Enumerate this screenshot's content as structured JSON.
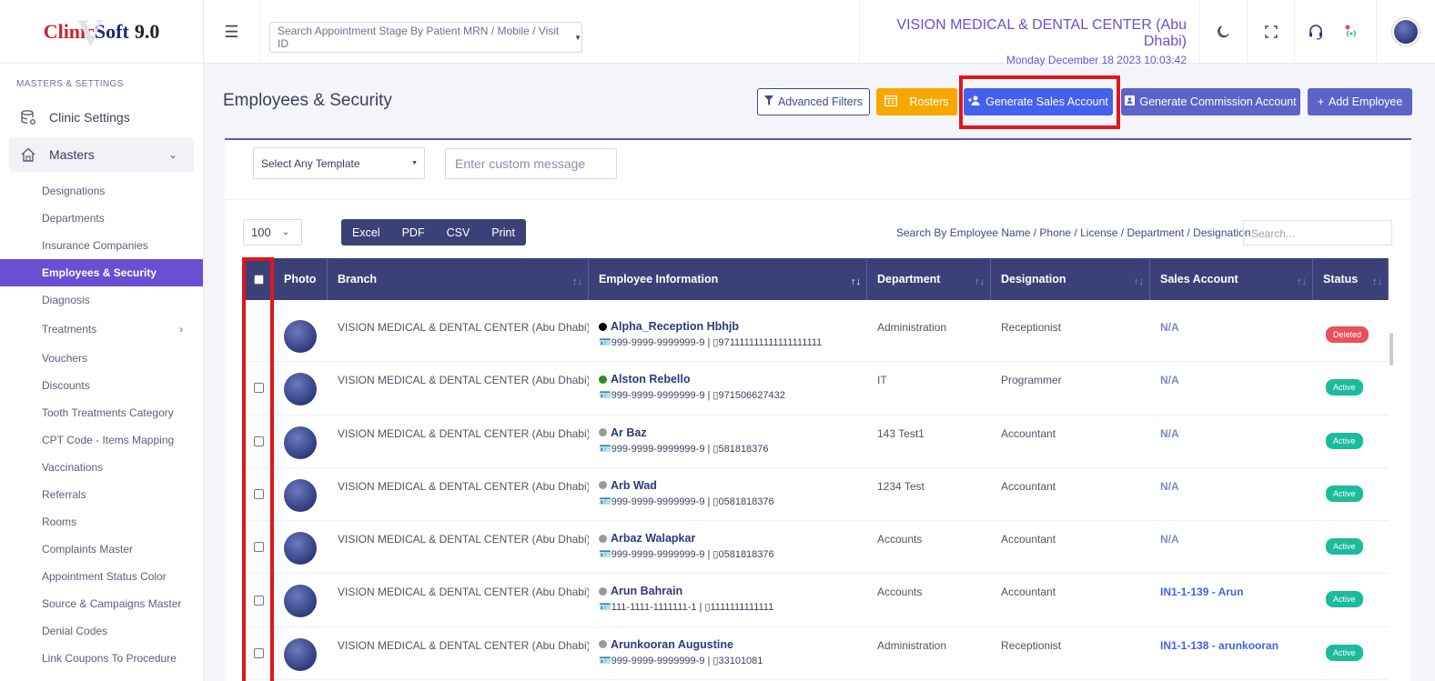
{
  "brand": {
    "part1": "Clinic",
    "part2": "Soft",
    "version": "9.0"
  },
  "sidebar": {
    "section": "MASTERS & SETTINGS",
    "clinic_settings": "Clinic Settings",
    "masters": "Masters",
    "items": [
      "Designations",
      "Departments",
      "Insurance Companies",
      "Employees & Security",
      "Diagnosis",
      "Treatments",
      "Vouchers",
      "Discounts",
      "Tooth Treatments Category",
      "CPT Code - Items Mapping",
      "Vaccinations",
      "Referrals",
      "Rooms",
      "Complaints Master",
      "Appointment Status Color",
      "Source & Campaigns Master",
      "Denial Codes",
      "Link Coupons To Procedure"
    ],
    "active_item": "Employees & Security"
  },
  "topbar": {
    "search_placeholder": "Search Appointment Stage By Patient MRN / Mobile / Visit ID",
    "clinic_name": "VISION MEDICAL & DENTAL CENTER (Abu Dhabi)",
    "datetime": "Monday December 18 2023 10:03:42"
  },
  "page": {
    "title": "Employees & Security",
    "buttons": {
      "advanced_filters": "Advanced Filters",
      "rosters": "Rosters",
      "generate_sales": "Generate Sales Account",
      "generate_commission": "Generate Commission Account",
      "add_employee": "Add Employee"
    },
    "template_select": "Select Any Template",
    "custom_message_placeholder": "Enter custom message",
    "page_length": "100",
    "export": [
      "Excel",
      "PDF",
      "CSV",
      "Print"
    ],
    "search_label": "Search By Employee Name / Phone / License / Department / Designation",
    "search_placeholder": "Search..."
  },
  "table": {
    "columns": [
      "Photo",
      "Branch",
      "Employee Information",
      "Department",
      "Designation",
      "Sales Account",
      "Status"
    ],
    "rows": [
      {
        "branch": "VISION MEDICAL & DENTAL CENTER (Abu Dhabi)",
        "name": "Alpha_Reception Hbhjb",
        "dot": "#000000",
        "meta": "🪪999-9999-9999999-9 | ▯971111111111111111111",
        "department": "Administration",
        "designation": "Receptionist",
        "sales": "N/A",
        "status": "Deleted"
      },
      {
        "branch": "VISION MEDICAL & DENTAL CENTER (Abu Dhabi)",
        "name": "Alston Rebello",
        "dot": "#2e8b1f",
        "meta": "🪪999-9999-9999999-9 | ▯971506627432",
        "department": "IT",
        "designation": "Programmer",
        "sales": "N/A",
        "status": "Active"
      },
      {
        "branch": "VISION MEDICAL & DENTAL CENTER (Abu Dhabi)",
        "name": "Ar Baz",
        "dot": "#999999",
        "meta": "🪪999-9999-9999999-9 | ▯581818376",
        "department": "143 Test1",
        "designation": "Accountant",
        "sales": "N/A",
        "status": "Active"
      },
      {
        "branch": "VISION MEDICAL & DENTAL CENTER (Abu Dhabi)",
        "name": "Arb Wad",
        "dot": "#999999",
        "meta": "🪪999-9999-9999999-9 | ▯0581818376",
        "department": "1234 Test",
        "designation": "Accountant",
        "sales": "N/A",
        "status": "Active"
      },
      {
        "branch": "VISION MEDICAL & DENTAL CENTER (Abu Dhabi)",
        "name": "Arbaz Walapkar",
        "dot": "#999999",
        "meta": "🪪999-9999-9999999-9 | ▯0581818376",
        "department": "Accounts",
        "designation": "Accountant",
        "sales": "N/A",
        "status": "Active"
      },
      {
        "branch": "VISION MEDICAL & DENTAL CENTER (Abu Dhabi)",
        "name": "Arun Bahrain",
        "dot": "#999999",
        "meta": "🪪111-1111-1111111-1 | ▯1111111111111",
        "department": "Accounts",
        "designation": "Accountant",
        "sales": "IN1-1-139 - Arun",
        "status": "Active"
      },
      {
        "branch": "VISION MEDICAL & DENTAL CENTER (Abu Dhabi)",
        "name": "Arunkooran Augustine",
        "dot": "#999999",
        "meta": "🪪999-9999-9999999-9 | ▯33101081",
        "department": "Administration",
        "designation": "Receptionist",
        "sales": "IN1-1-138 - arunkooran",
        "status": "Active"
      }
    ]
  },
  "colors": {
    "accent": "#6a4fd3",
    "header": "#3b4178",
    "highlight": "#e0161c",
    "active": "#1abc9c",
    "deleted": "#e7515a"
  },
  "icons": [
    "hamburger-icon",
    "moon-icon",
    "fullscreen-icon",
    "headset-icon",
    "broadcast-icon",
    "filter-icon",
    "calendar-icon",
    "user-plus-icon",
    "id-card-icon",
    "plus-icon"
  ]
}
